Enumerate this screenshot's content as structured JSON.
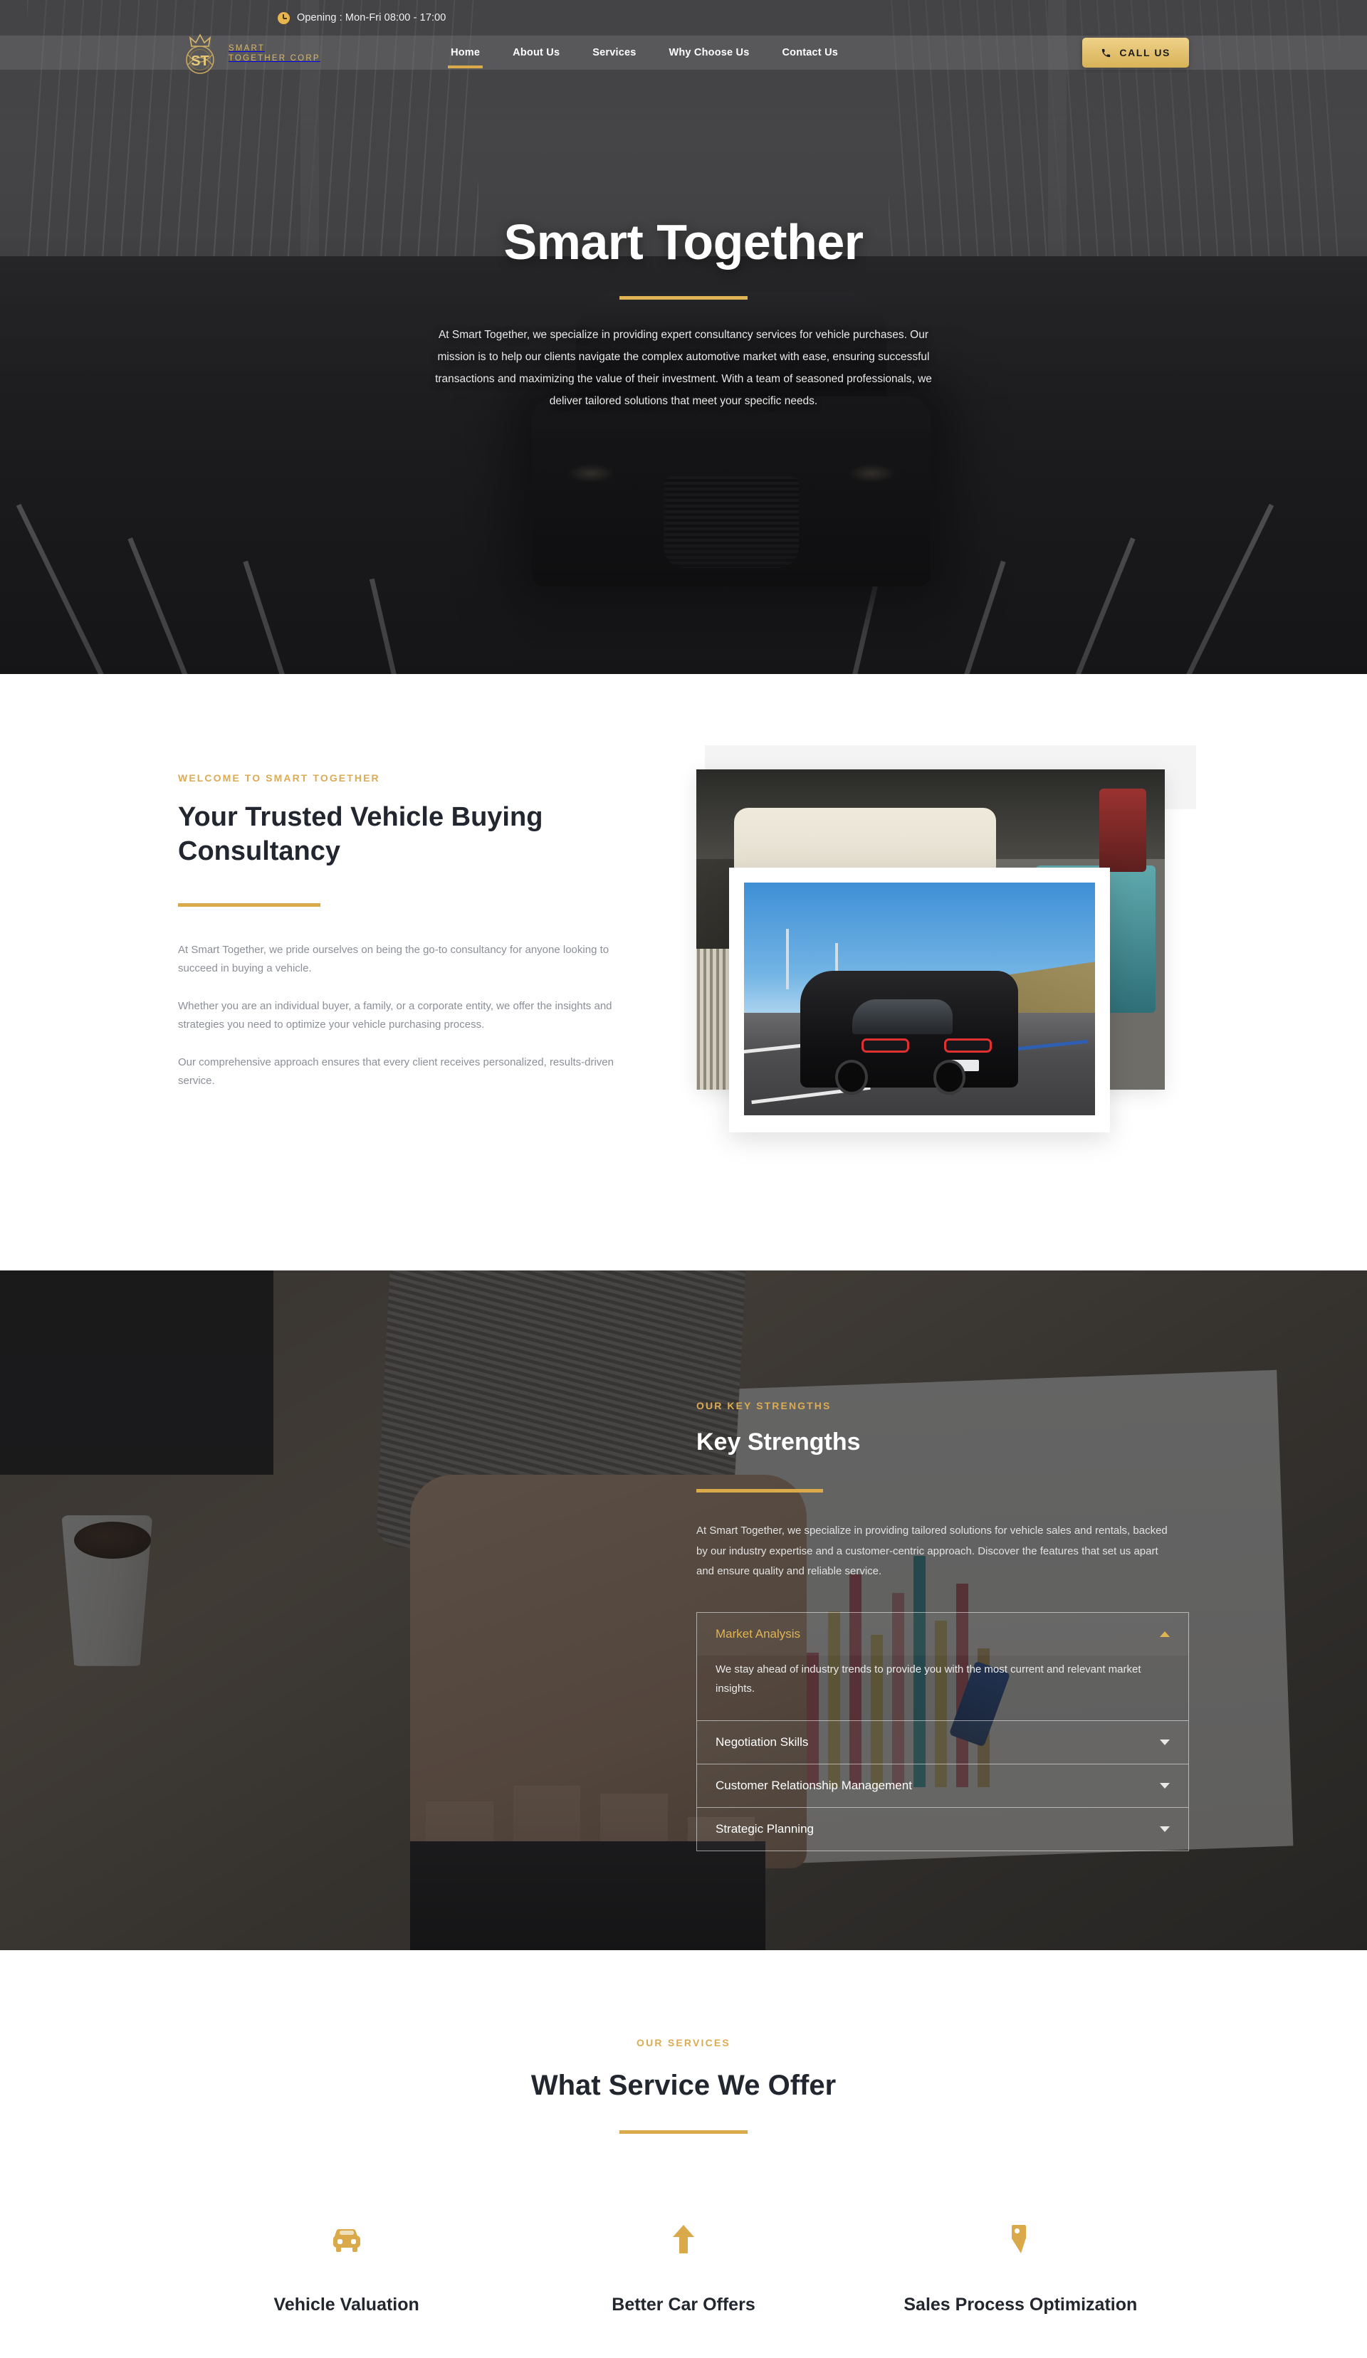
{
  "topbar": {
    "hours_text": "Opening : Mon-Fri 08:00 - 17:00",
    "clock_icon": "clock-icon"
  },
  "brand": {
    "line1": "SMART",
    "line2": "TOGETHER CORP",
    "monogram": "ST",
    "logo_color": "#d8b76a"
  },
  "nav": {
    "items": [
      {
        "label": "Home",
        "active": true
      },
      {
        "label": "About Us",
        "active": false
      },
      {
        "label": "Services",
        "active": false
      },
      {
        "label": "Why Choose Us",
        "active": false
      },
      {
        "label": "Contact Us",
        "active": false
      }
    ],
    "cta": {
      "label": "CALL US",
      "icon": "phone-icon"
    }
  },
  "hero": {
    "title": "Smart Together",
    "paragraph": "At Smart Together, we specialize in providing expert consultancy services for vehicle purchases. Our mission is to help our clients navigate the complex automotive market with ease, ensuring successful transactions and maximizing the value of their investment. With a team of seasoned professionals, we deliver tailored solutions that meet your specific needs."
  },
  "about": {
    "eyebrow": "WELCOME TO SMART TOGETHER",
    "heading": "Your Trusted Vehicle Buying Consultancy",
    "paragraphs": [
      "At Smart Together, we pride ourselves on being the go-to consultancy for anyone looking to succeed in buying a vehicle.",
      "Whether you are an individual buyer, a family, or a corporate entity, we offer the insights and strategies you need to optimize your vehicle purchasing process.",
      "Our comprehensive approach ensures that every client receives personalized, results-driven service."
    ]
  },
  "strengths": {
    "eyebrow": "OUR KEY STRENGTHS",
    "heading": "Key Strengths",
    "paragraph": "At Smart Together, we specialize in providing tailored solutions for vehicle sales and rentals, backed by our industry expertise and a customer-centric approach. Discover the features that set us apart and ensure quality and reliable service.",
    "accordion": [
      {
        "title": "Market Analysis",
        "body": "We stay ahead of industry trends to provide you with the most current and relevant market insights.",
        "open": true
      },
      {
        "title": "Negotiation Skills",
        "body": "",
        "open": false
      },
      {
        "title": "Customer Relationship Management",
        "body": "",
        "open": false
      },
      {
        "title": "Strategic Planning",
        "body": "",
        "open": false
      }
    ]
  },
  "services": {
    "eyebrow": "OUR SERVICES",
    "heading": "What Service We Offer",
    "cards": [
      {
        "title": "Vehicle Valuation",
        "icon": "car-icon"
      },
      {
        "title": "Better Car Offers",
        "icon": "arrow-up-icon"
      },
      {
        "title": "Sales Process Optimization",
        "icon": "price-tag-icon"
      }
    ]
  },
  "colors": {
    "gold": "#d9a94a",
    "gold_light": "#e0b455",
    "gold_text": "#dbab56",
    "dark_text": "#22262e",
    "muted_text": "#8b8f97"
  }
}
